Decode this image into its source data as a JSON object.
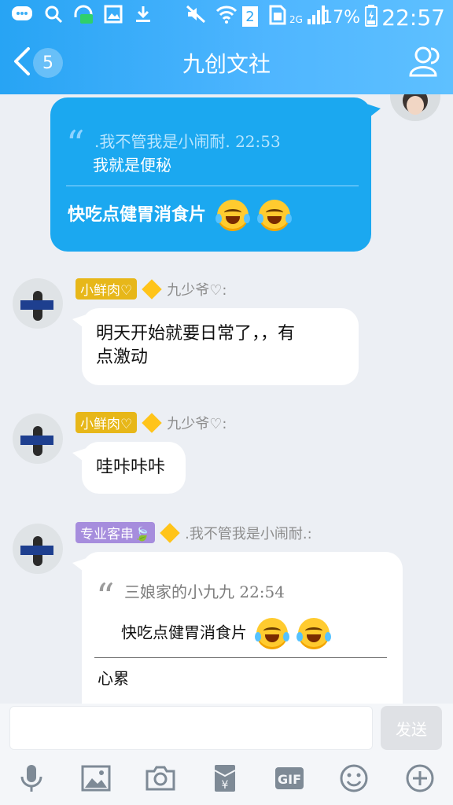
{
  "status_bar": {
    "signal_label": "2G",
    "sim_number": "2",
    "battery": "17%",
    "time": "22:57"
  },
  "header": {
    "unread_count": "5",
    "title": "九创文社"
  },
  "messages": [
    {
      "quote_author": ".我不管我是小闹耐.  22:53",
      "quote_text": "我就是便秘",
      "text": "快吃点健胃消食片"
    },
    {
      "tag": "小鲜肉♡",
      "sender": "九少爷♡:",
      "text_line1": "明天开始就要日常了，，有",
      "text_line2": "点激动"
    },
    {
      "tag": "小鲜肉♡",
      "sender": "九少爷♡:",
      "text": "哇咔咔咔"
    },
    {
      "tag": "专业客串🍃",
      "sender": ".我不管我是小闹耐.:",
      "quote_author": "三娘家的小九九  22:54",
      "quote_text": "快吃点健胃消食片",
      "reply": "心累"
    }
  ],
  "input": {
    "value": "",
    "send_label": "发送"
  },
  "toolbar": {
    "items": [
      "microphone-icon",
      "image-icon",
      "camera-icon",
      "red-packet-icon",
      "gif-icon",
      "emoji-icon",
      "plus-icon"
    ],
    "gif_label": "GIF"
  }
}
